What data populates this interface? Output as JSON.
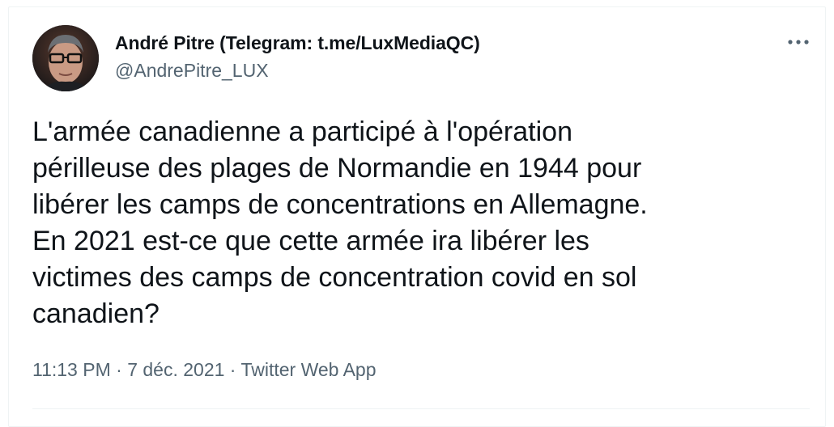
{
  "author": {
    "display_name": "André Pitre (Telegram: t.me/LuxMediaQC)",
    "handle": "@AndrePitre_LUX"
  },
  "more_icon": "more-horizontal-icon",
  "tweet": {
    "lines": [
      "L'armée canadienne a participé à l'opération",
      "périlleuse des plages de Normandie en 1944 pour",
      "libérer les camps de concentrations en Allemagne.",
      "En 2021 est-ce que cette armée ira libérer les",
      "victimes des camps de concentration covid en sol",
      "canadien?"
    ]
  },
  "meta": {
    "time": "11:13 PM",
    "separator": " · ",
    "date": "7 déc. 2021",
    "source": "Twitter Web App"
  },
  "colors": {
    "text": "#0f1419",
    "secondary": "#536471",
    "border": "#eff3f4"
  }
}
